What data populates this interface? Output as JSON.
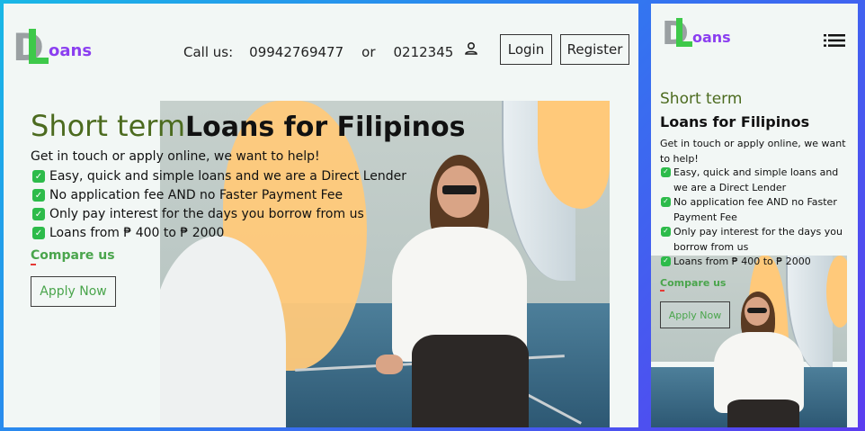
{
  "brand": {
    "logo_letter": "D",
    "logo_word": "oans"
  },
  "header": {
    "call_label": "Call us:",
    "phone_primary": "09942769477",
    "or_label": "or",
    "phone_secondary": "0212345",
    "login_label": "Login",
    "register_label": "Register"
  },
  "hero": {
    "title_light": "Short term",
    "title_bold": "Loans for Filipinos",
    "intro": "Get in touch or apply online, we want to help!",
    "bullets": [
      "Easy, quick and simple loans and we are a Direct Lender",
      "No application fee AND no Faster Payment Fee",
      "Only pay interest for the days you borrow from us",
      "Loans from ₱ 400 to ₱ 2000"
    ],
    "compare_label": "Compare us",
    "apply_label": "Apply Now"
  },
  "icons": {
    "user": "user-icon",
    "menu": "hamburger-menu-icon",
    "check": "check-icon"
  },
  "colors": {
    "brand_purple": "#8b3ff0",
    "brand_green": "#3ec94a",
    "title_green": "#4c6b1f",
    "link_green": "#4aa54c",
    "check_green": "#2dbb4a",
    "accent_orange": "#ffc97a",
    "background": "#f2f7f5"
  }
}
